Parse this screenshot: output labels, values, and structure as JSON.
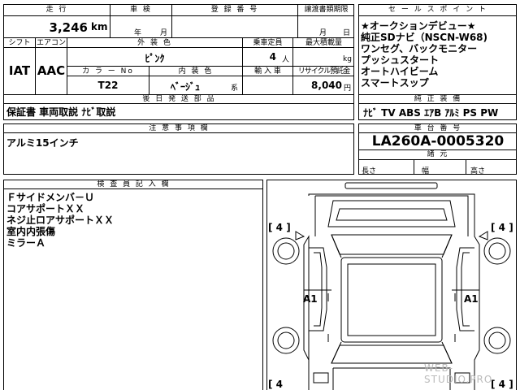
{
  "top": {
    "mileage_header": "走 行",
    "mileage": "3,246",
    "mileage_unit": "km",
    "shaken_header": "車 検",
    "shaken_year": "年",
    "shaken_month": "月",
    "reg_header": "登 録 番 号",
    "transfer_header": "譲渡書類期限",
    "transfer_month": "月",
    "transfer_day": "日"
  },
  "specs": {
    "shift_header": "シフト",
    "shift": "IAT",
    "aircon_header": "エアコン",
    "aircon": "AAC",
    "ext_color_header": "外 装 色",
    "ext_color": "ﾋﾟﾝｸ",
    "capacity_header": "乗車定員",
    "capacity": "4",
    "capacity_unit": "人",
    "loadcap_header": "最大積載量",
    "loadcap_unit": "kg",
    "color_no_header": "カ ラ ー No",
    "color_no": "T22",
    "int_color_header": "内 装 色",
    "int_color": "ﾍﾞｰｼﾞｭ",
    "int_color_suffix": "系",
    "import_header": "輸 入 車",
    "recycle_header": "リサイクル預託金",
    "recycle": "8,040",
    "recycle_unit": "円"
  },
  "docs": {
    "header": "後 日 発 送 部 品",
    "text": "保証書 車両取説 ﾅﾋﾞ取説"
  },
  "sales": {
    "header": "セ ー ル ス ポ イ ン ト",
    "lines": [
      "★オークションデビュー★",
      "純正SDナビ（NSCN-W68)",
      "ワンセグ、バックモニター",
      "プッシュスタート",
      "オートハイビーム",
      "スマートスップ"
    ]
  },
  "equipment": {
    "header": "純 正 装 備",
    "items": "ﾅﾋﾞ TV ABS ｴｱB ｱﾙﾐ PS PW"
  },
  "notes": {
    "header": "注 意 事 項 欄",
    "text": "アルミ15インチ"
  },
  "chassis": {
    "header": "車 台 番 号",
    "value": "LA260A-0005320",
    "dims_header": "諸 元",
    "length": "長さ",
    "width": "幅",
    "height": "高さ"
  },
  "inspector": {
    "header": "検 査 員 記 入 欄",
    "lines": [
      "Ｆサイドメンバ－Ｕ",
      "コアサポートＸＸ",
      "ネジ止ロアサポートＸＸ",
      "室内内張傷",
      "ミラーＡ"
    ]
  },
  "diagram": {
    "tire_fl": "[ 4 ]",
    "tire_fr": "[ 4 ]",
    "tire_rl": "[ 4",
    "tire_rr": "[ 4 ]",
    "mark_left": "A1",
    "mark_right": "A1"
  },
  "watermark": "WEB-STUDIO.PRO"
}
